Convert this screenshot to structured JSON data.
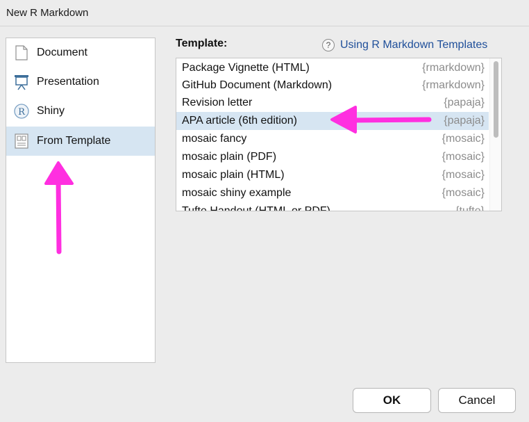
{
  "window": {
    "title": "New R Markdown"
  },
  "sidebar": {
    "items": [
      {
        "label": "Document",
        "icon": "document-icon"
      },
      {
        "label": "Presentation",
        "icon": "presentation-icon"
      },
      {
        "label": "Shiny",
        "icon": "shiny-r-icon"
      },
      {
        "label": "From Template",
        "icon": "template-icon",
        "selected": true
      }
    ]
  },
  "templates": {
    "label": "Template:",
    "help_link": "Using R Markdown Templates",
    "help_icon": "question-circle-icon",
    "rows": [
      {
        "name": "Package Vignette (HTML)",
        "pkg": "{rmarkdown}"
      },
      {
        "name": "GitHub Document (Markdown)",
        "pkg": "{rmarkdown}"
      },
      {
        "name": "Revision letter",
        "pkg": "{papaja}"
      },
      {
        "name": "APA article (6th edition)",
        "pkg": "{papaja}",
        "selected": true
      },
      {
        "name": "mosaic fancy",
        "pkg": "{mosaic}"
      },
      {
        "name": "mosaic plain (PDF)",
        "pkg": "{mosaic}"
      },
      {
        "name": "mosaic plain (HTML)",
        "pkg": "{mosaic}"
      },
      {
        "name": "mosaic shiny example",
        "pkg": "{mosaic}"
      },
      {
        "name": "Tufte Handout (HTML or PDF)",
        "pkg": "{tufte}"
      }
    ]
  },
  "buttons": {
    "ok": "OK",
    "cancel": "Cancel"
  },
  "colors": {
    "annotation": "#ff2fe0",
    "selection": "#d6e5f2",
    "link": "#1f4f9a"
  }
}
